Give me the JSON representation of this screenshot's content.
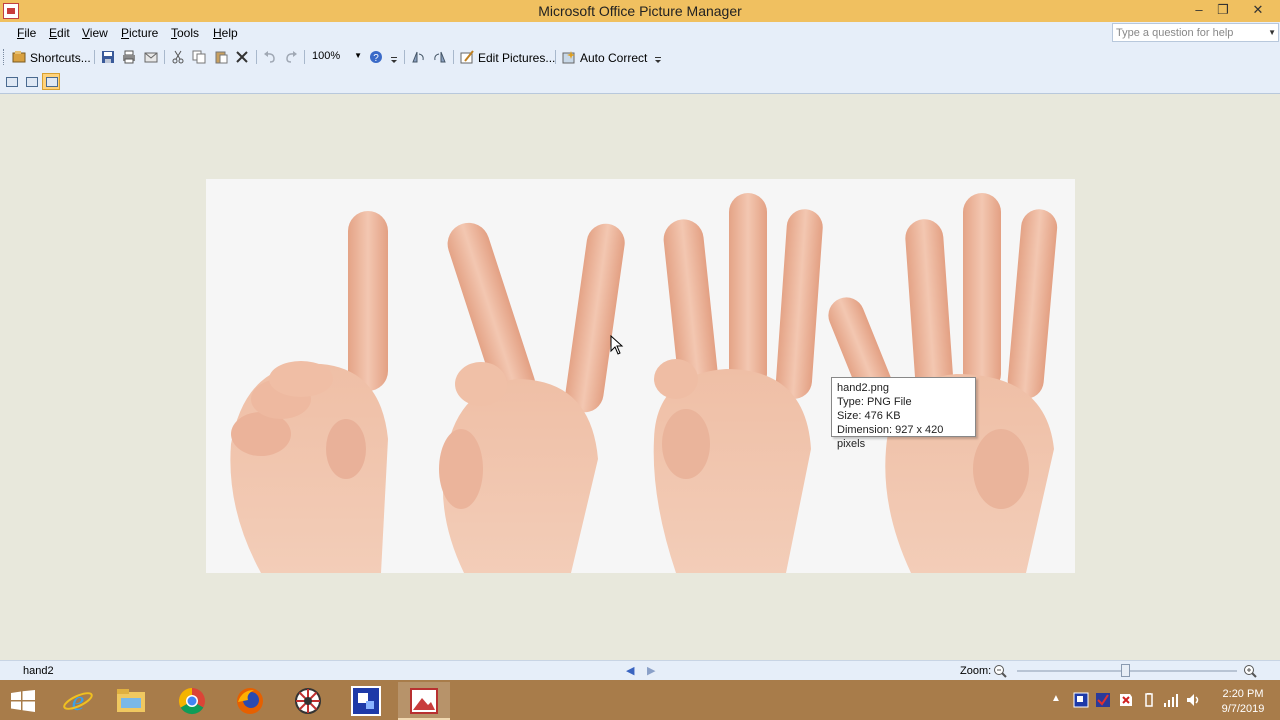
{
  "window": {
    "title": "Microsoft Office Picture Manager",
    "min_glyph": "–",
    "max_glyph": "❐",
    "close_glyph": "✕"
  },
  "menu": {
    "items": [
      "File",
      "Edit",
      "View",
      "Picture",
      "Tools",
      "Help"
    ],
    "help_placeholder": "Type a question for help"
  },
  "toolbar": {
    "shortcuts_label": "Shortcuts...",
    "zoom_value": "100%",
    "edit_pictures_label": "Edit Pictures...",
    "auto_correct_label": "Auto Correct"
  },
  "tooltip": {
    "filename": "hand2.png",
    "type": "Type: PNG File",
    "size": "Size: 476 KB",
    "dimension": "Dimension: 927 x 420 pixels"
  },
  "status": {
    "current_name": "hand2",
    "zoom_label": "Zoom:",
    "prev_glyph": "◀",
    "next_glyph": "▶"
  },
  "taskbar": {
    "time": "2:20 PM",
    "date": "9/7/2019",
    "apps": [
      "start-icon",
      "internet-explorer-icon",
      "file-explorer-icon",
      "chrome-icon",
      "firefox-icon",
      "settings-app-icon",
      "blue-app-icon",
      "picture-manager-icon"
    ]
  },
  "colors": {
    "title_bar": "#f0c060",
    "toolbar_bg": "#e6eef9",
    "workspace": "#e8e8dc",
    "taskbar": "#a87c4a",
    "active_view": "#ffd27a"
  }
}
